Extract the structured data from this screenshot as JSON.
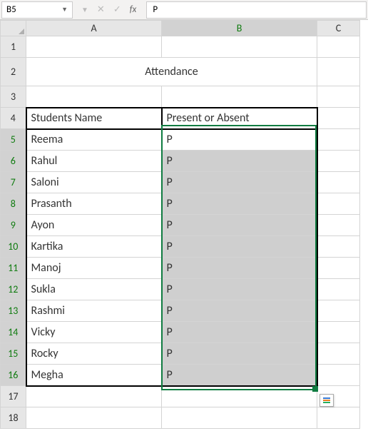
{
  "namebox": "B5",
  "formula_value": "P",
  "col_headers": [
    "A",
    "B",
    "C"
  ],
  "row_headers": [
    "1",
    "2",
    "3",
    "4",
    "5",
    "6",
    "7",
    "8",
    "9",
    "10",
    "11",
    "12",
    "13",
    "14",
    "15",
    "16",
    "17",
    "18"
  ],
  "title": "Attendance",
  "header_A": "Students Name",
  "header_B": "Present or Absent",
  "students": [
    "Reema",
    "Rahul",
    "Saloni",
    "Prasanth",
    "Ayon",
    "Kartika",
    "Manoj",
    "Sukla",
    "Rashmi",
    "Vicky",
    "Rocky",
    "Megha"
  ],
  "status": [
    "P",
    "P",
    "P",
    "P",
    "P",
    "P",
    "P",
    "P",
    "P",
    "P",
    "P",
    "P"
  ],
  "chart_data": {
    "type": "table",
    "title": "Attendance",
    "categories": [
      "Reema",
      "Rahul",
      "Saloni",
      "Prasanth",
      "Ayon",
      "Kartika",
      "Manoj",
      "Sukla",
      "Rashmi",
      "Vicky",
      "Rocky",
      "Megha"
    ],
    "values": [
      "P",
      "P",
      "P",
      "P",
      "P",
      "P",
      "P",
      "P",
      "P",
      "P",
      "P",
      "P"
    ],
    "xlabel": "Students Name",
    "ylabel": "Present or Absent"
  }
}
